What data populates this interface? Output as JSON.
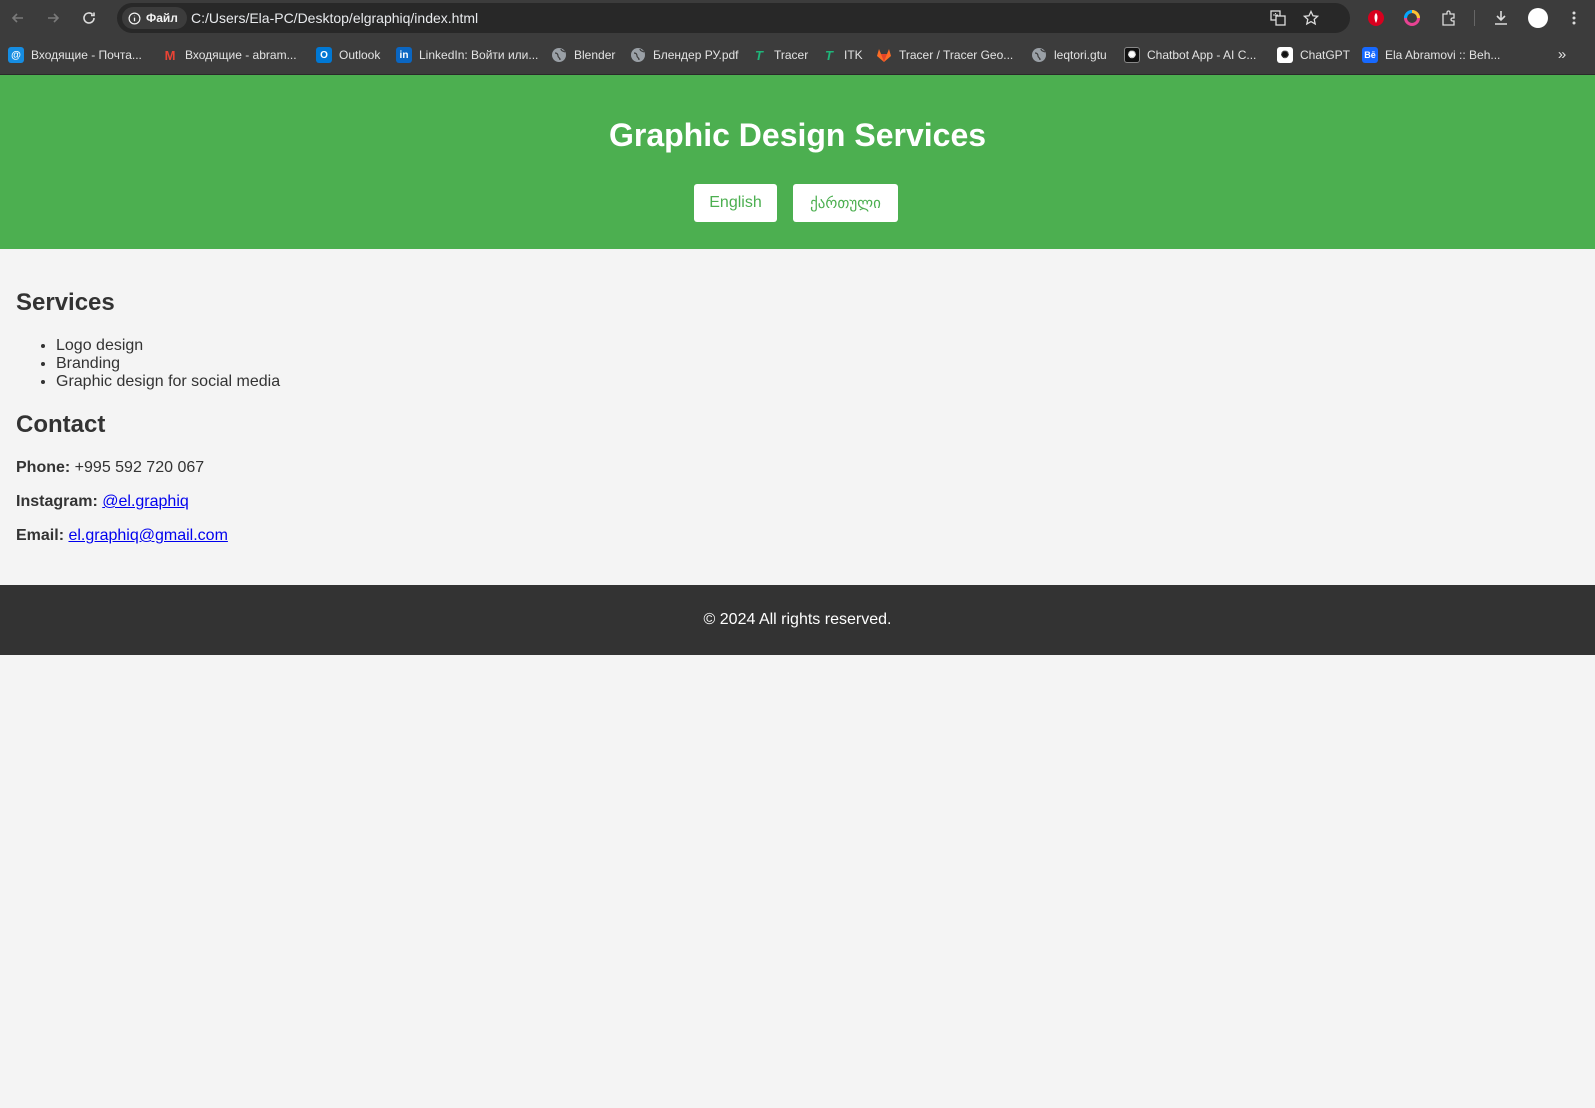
{
  "browser": {
    "url": "C:/Users/Ela-PC/Desktop/elgraphiq/index.html",
    "site_chip_label": "Файл"
  },
  "bookmarks": [
    {
      "label": "Входящие - Почта...",
      "icon": "mail-ru-icon",
      "color": "#168de2"
    },
    {
      "label": "Входящие - abram...",
      "icon": "gmail-icon",
      "color": "#ea4335"
    },
    {
      "label": "Outlook",
      "icon": "outlook-icon",
      "color": "#0078d4"
    },
    {
      "label": "LinkedIn: Войти или...",
      "icon": "linkedin-icon",
      "color": "#0a66c2"
    },
    {
      "label": "Blender",
      "icon": "globe-icon",
      "color": "#9aa0a6"
    },
    {
      "label": "Блендер РУ.pdf",
      "icon": "globe-icon",
      "color": "#9aa0a6"
    },
    {
      "label": "Tracer",
      "icon": "tracer-icon",
      "color": "#1fb57a"
    },
    {
      "label": "ITK",
      "icon": "tracer-icon",
      "color": "#1fb57a"
    },
    {
      "label": "Tracer / Tracer Geo...",
      "icon": "gitlab-icon",
      "color": "#fc6d26"
    },
    {
      "label": "leqtori.gtu",
      "icon": "globe-icon",
      "color": "#9aa0a6"
    },
    {
      "label": "Chatbot App - AI C...",
      "icon": "chatbot-icon",
      "color": "#111111"
    },
    {
      "label": "ChatGPT",
      "icon": "chatgpt-icon",
      "color": "#ffffff"
    },
    {
      "label": "Ela Abramovi :: Beh...",
      "icon": "behance-icon",
      "color": "#1769ff"
    }
  ],
  "header": {
    "title": "Graphic Design Services",
    "lang_english": "English",
    "lang_georgian": "ქართული"
  },
  "services": {
    "heading": "Services",
    "items": [
      "Logo design",
      "Branding",
      "Graphic design for social media"
    ]
  },
  "contact": {
    "heading": "Contact",
    "phone_label": "Phone:",
    "phone_value": "+995 592 720 067",
    "instagram_label": "Instagram:",
    "instagram_value": "@el.graphiq",
    "email_label": "Email:",
    "email_value": "el.graphiq@gmail.com"
  },
  "footer": {
    "text": "© 2024 All rights reserved."
  },
  "colors": {
    "accent": "#4caf50",
    "footer": "#333333",
    "link": "#0000ee"
  }
}
